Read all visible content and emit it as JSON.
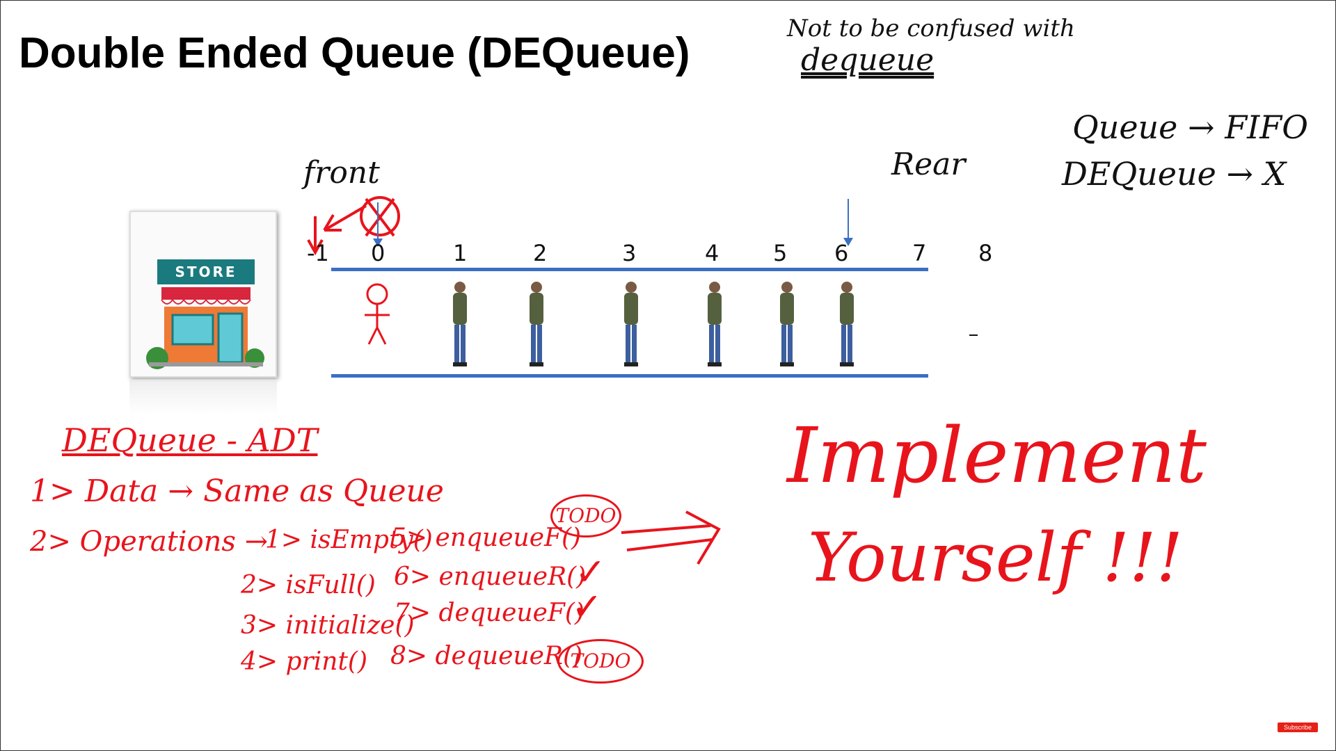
{
  "slide": {
    "title": "Double Ended Queue (DEQueue)",
    "note_line1": "Not to be confused with",
    "note_line2": "dequeue",
    "queue_fifo": "Queue → FIFO",
    "dequeue_x": "DEQueue → X",
    "front_label": "front",
    "rear_label": "Rear",
    "indices": [
      "-1",
      "0",
      "1",
      "2",
      "3",
      "4",
      "5",
      "6",
      "7",
      "8"
    ],
    "adt_title": "DEQueue - ADT",
    "adt_data": "1> Data → Same as Queue",
    "adt_ops_prefix": "2> Operations →",
    "ops": {
      "op1": "1> isEmpty()",
      "op2": "2> isFull()",
      "op3": "3> initialize()",
      "op4": "4> print()",
      "op5": "5> enqueueF()",
      "op6": "6> enqueueR()",
      "op7": "7> dequeueF()",
      "op8": "8> dequeueR()"
    },
    "todo_label": "TODO",
    "check_mark": "✓",
    "implement_line1": "Implement",
    "implement_line2": "Yourself !!!",
    "store_sign": "STORE",
    "subscribe": "Subscribe"
  },
  "colors": {
    "ink_red": "#e8141c",
    "ink_black": "#111111",
    "lane_blue": "#3a6fc4"
  }
}
